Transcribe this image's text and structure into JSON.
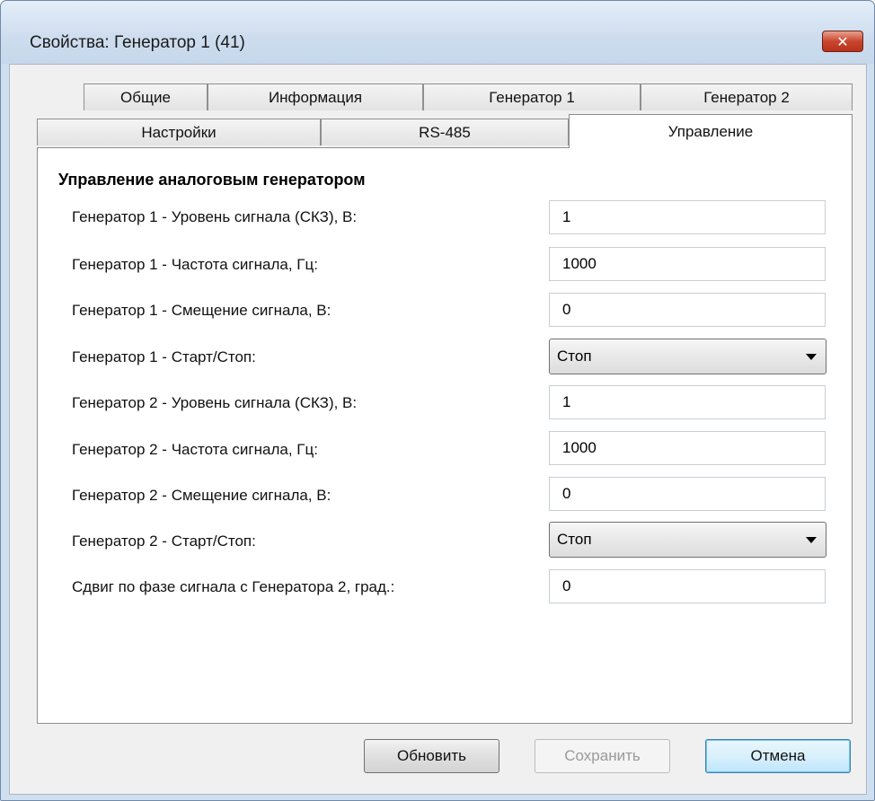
{
  "window": {
    "title": "Свойства: Генератор 1 (41)",
    "close_symbol": "✕"
  },
  "tabs_back": [
    "Общие",
    "Информация",
    "Генератор 1",
    "Генератор 2"
  ],
  "tabs_front": [
    "Настройки",
    "RS-485",
    "Управление"
  ],
  "active_tab": "Управление",
  "group": {
    "title": "Управление аналоговым генератором",
    "rows": [
      {
        "label": "Генератор 1 - Уровень сигнала (СКЗ), В:",
        "value": "1",
        "type": "text"
      },
      {
        "label": "Генератор 1 - Частота сигнала,   Гц:",
        "value": "1000",
        "type": "text"
      },
      {
        "label": "Генератор 1 - Смещение сигнала, В:",
        "value": "0",
        "type": "text"
      },
      {
        "label": "Генератор 1 - Старт/Стоп:",
        "value": "Стоп",
        "type": "select"
      },
      {
        "label": "Генератор 2 - Уровень сигнала (СКЗ), В:",
        "value": "1",
        "type": "text"
      },
      {
        "label": "Генератор 2 - Частота сигнала,   Гц:",
        "value": "1000",
        "type": "text"
      },
      {
        "label": "Генератор 2 - Смещение сигнала, В:",
        "value": "0",
        "type": "text"
      },
      {
        "label": "Генератор 2 - Старт/Стоп:",
        "value": "Стоп",
        "type": "select"
      },
      {
        "label": "Сдвиг по фазе сигнала с Генератора 2, град.:",
        "value": "0",
        "type": "text"
      }
    ]
  },
  "buttons": {
    "refresh": "Обновить",
    "save": "Сохранить",
    "cancel": "Отмена"
  },
  "colors": {
    "title_bg": "#cddcee",
    "close_red": "#c9462e",
    "panel_bg": "#ffffff",
    "client_bg": "#f0f0f0"
  }
}
